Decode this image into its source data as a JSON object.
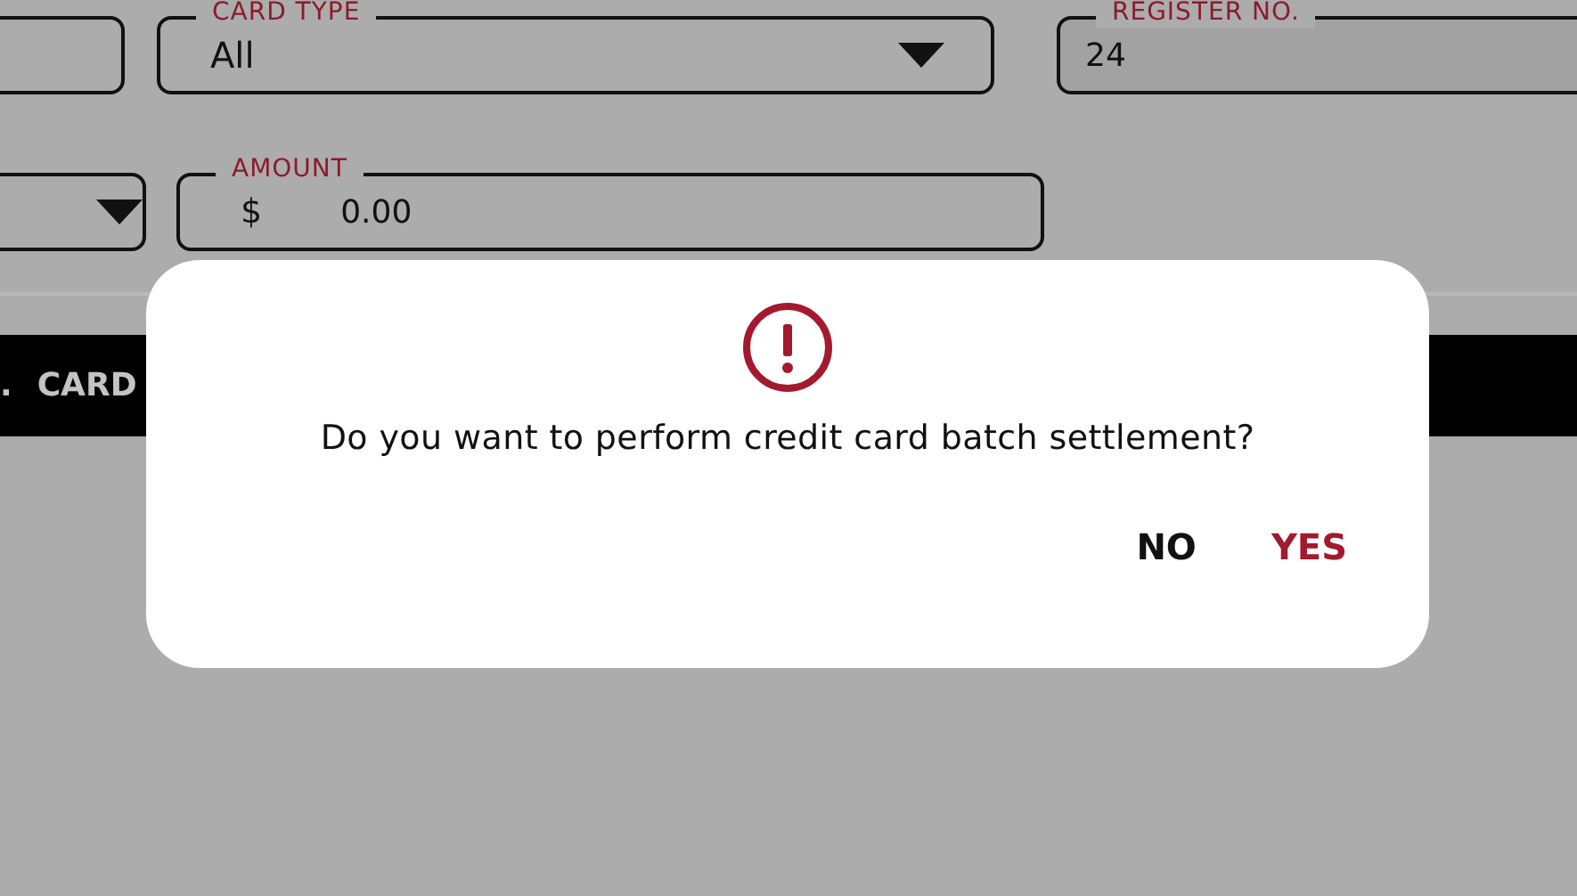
{
  "form": {
    "rows": [
      {
        "fields": [
          {
            "kind": "input"
          },
          {
            "kind": "select",
            "label": "CARD TYPE",
            "value": "All"
          },
          {
            "kind": "readonly",
            "label": "REGISTER NO.",
            "value": "24"
          }
        ]
      },
      {
        "fields": [
          {
            "kind": "select"
          },
          {
            "kind": "money",
            "label": "AMOUNT",
            "prefix": "$",
            "value": "0.00"
          }
        ]
      }
    ]
  },
  "table": {
    "columns": [
      ".",
      "CARD"
    ]
  },
  "dialog": {
    "message": "Do you want to perform credit card batch settlement?",
    "buttons": [
      {
        "label": "NO",
        "kind": "secondary"
      },
      {
        "label": "YES",
        "kind": "primary"
      }
    ]
  }
}
